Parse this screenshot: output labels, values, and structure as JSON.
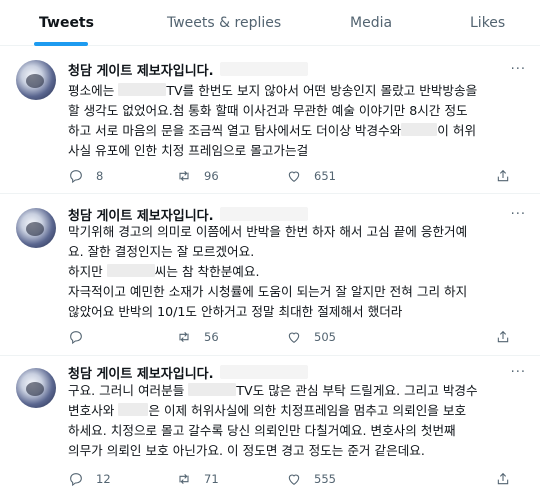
{
  "tabs": [
    {
      "label": "Tweets",
      "active": true
    },
    {
      "label": "Tweets & replies",
      "active": false
    },
    {
      "label": "Media",
      "active": false
    },
    {
      "label": "Likes",
      "active": false
    }
  ],
  "accent_color": "#1d9bf0",
  "tweets": [
    {
      "author": "청담 게이트 제보자입니다.",
      "more": "···",
      "lines": [
        [
          "평소에는 ",
          "",
          "TV를 한번도 보지 않아서 어떤 방송인지 몰랐고 반박방송을"
        ],
        [
          "할 생각도 없었어요.첨 통화 할때 이사건과 무관한  예술 이야기만 8시간 정도"
        ],
        [
          "하고 서로 마음의 문을 조금씩 열고 탐사에서도 더이상 박경수와",
          "",
          "이 허위"
        ],
        [
          "사실 유포에 인한 치정 프레임으로 몰고가는걸"
        ]
      ],
      "replies": "8",
      "retweets": "96",
      "likes": "651"
    },
    {
      "author": "청담 게이트 제보자입니다.",
      "more": "···",
      "lines": [
        [
          "막기위해 경고의 의미로 이쯤에서 반박을 한번 하자 해서 고심 끝에 응한거예"
        ],
        [
          "요. 잘한 결정인지는 잘 모르겠어요."
        ],
        [
          "하지만 ",
          "",
          "씨는 참 착한분예요."
        ],
        [
          "자극적이고 예민한 소재가 시청률에 도움이 되는거 잘 알지만 전혀 그리 하지"
        ],
        [
          "않았어요 반박의 10/1도 안하거고 정말 최대한 절제해서 했더라"
        ]
      ],
      "replies": "",
      "retweets": "56",
      "likes": "505"
    },
    {
      "author": "청담 게이트 제보자입니다.",
      "more": "···",
      "lines": [
        [
          "구요. 그러니 여러분들 ",
          "",
          "TV도 많은 관심 부탁 드릴게요. 그리고 박경수"
        ],
        [
          "변호사와 ",
          "",
          "은 이제 허위사실에 의한 치정프레임을 멈추고 의뢰인을 보호"
        ],
        [
          "하세요. 치정으로 몰고 갈수록 당신 의뢰인만 다칠거예요. 변호사의 첫번째"
        ],
        [
          "의무가 의뢰인 보호 아닌가요. 이 정도면 경고 정도는 준거 같은데요."
        ]
      ],
      "replies": "12",
      "retweets": "71",
      "likes": "555"
    }
  ],
  "icons": {
    "reply": "reply-icon",
    "retweet": "retweet-icon",
    "like": "heart-icon",
    "share": "share-icon"
  }
}
